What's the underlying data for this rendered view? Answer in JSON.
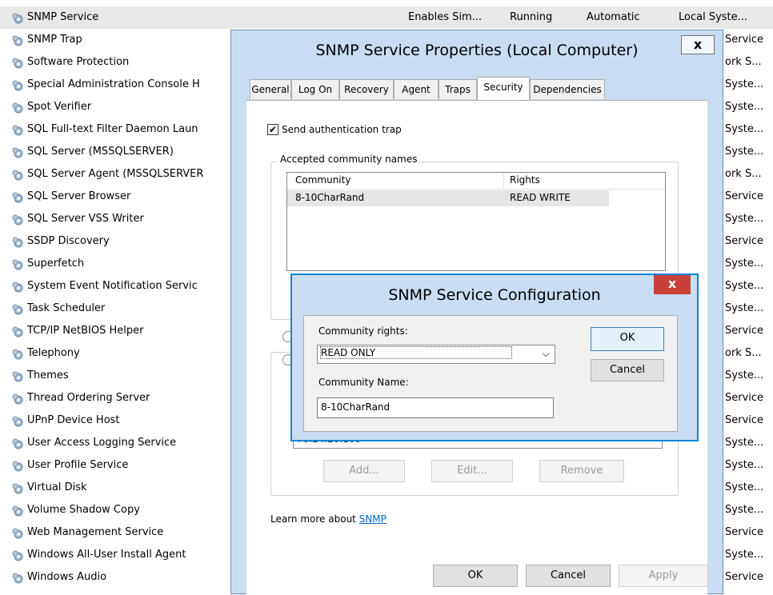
{
  "services": [
    {
      "name": "SNMP Service",
      "description": "Enables Sim...",
      "status": "Running",
      "startup": "Automatic",
      "logon": "Local Syste..."
    },
    {
      "name": "SNMP Trap",
      "logon": "Service"
    },
    {
      "name": "Software Protection",
      "logon": "ork S..."
    },
    {
      "name": "Special Administration Console H",
      "logon": "Syste..."
    },
    {
      "name": "Spot Verifier",
      "logon": "Syste..."
    },
    {
      "name": "SQL Full-text Filter Daemon Laun",
      "logon": "Syste..."
    },
    {
      "name": "SQL Server (MSSQLSERVER)",
      "logon": "Syste..."
    },
    {
      "name": "SQL Server Agent (MSSQLSERVER",
      "logon": "ork S..."
    },
    {
      "name": "SQL Server Browser",
      "logon": "Service"
    },
    {
      "name": "SQL Server VSS Writer",
      "logon": "Syste..."
    },
    {
      "name": "SSDP Discovery",
      "logon": "Service"
    },
    {
      "name": "Superfetch",
      "logon": "Syste..."
    },
    {
      "name": "System Event Notification Servic",
      "logon": "Syste..."
    },
    {
      "name": "Task Scheduler",
      "logon": "Syste..."
    },
    {
      "name": "TCP/IP NetBIOS Helper",
      "logon": "Service"
    },
    {
      "name": "Telephony",
      "logon": "ork S..."
    },
    {
      "name": "Themes",
      "logon": "Syste..."
    },
    {
      "name": "Thread Ordering Server",
      "logon": "Service"
    },
    {
      "name": "UPnP Device Host",
      "logon": "Service"
    },
    {
      "name": "User Access Logging Service",
      "logon": "Syste..."
    },
    {
      "name": "User Profile Service",
      "logon": "Syste..."
    },
    {
      "name": "Virtual Disk",
      "logon": "Syste..."
    },
    {
      "name": "Volume Shadow Copy",
      "logon": "Syste..."
    },
    {
      "name": "Web Management Service",
      "logon": "Service"
    },
    {
      "name": "Windows All-User Install Agent",
      "logon": "Syste..."
    },
    {
      "name": "Windows Audio",
      "logon": "Service"
    }
  ],
  "properties": {
    "title": "SNMP Service Properties (Local Computer)",
    "close": "x",
    "tabs": [
      "General",
      "Log On",
      "Recovery",
      "Agent",
      "Traps",
      "Security",
      "Dependencies"
    ],
    "active_tab": "Security",
    "auth_trap_label": "Send authentication trap",
    "auth_trap_checked": true,
    "community_group_title": "Accepted community names",
    "columns": [
      "Community",
      "Rights"
    ],
    "communities": [
      {
        "community": "8-10CharRand",
        "rights": "READ WRITE"
      }
    ],
    "host_partial": "70.24.26.100",
    "add": "Add...",
    "edit": "Edit...",
    "remove": "Remove",
    "learn_prefix": "Learn more about ",
    "learn_link": "SNMP",
    "ok": "OK",
    "cancel": "Cancel",
    "apply": "Apply"
  },
  "config_dialog": {
    "title": "SNMP Service Configuration",
    "close": "x",
    "rights_label": "Community rights:",
    "rights_value": "READ ONLY",
    "name_label": "Community Name:",
    "name_value": "8-10CharRand",
    "ok": "OK",
    "cancel": "Cancel"
  },
  "colors": {
    "accent": "#0a84d8",
    "title_bg": "#c9dcf1",
    "close_red": "#c7413a",
    "link": "#0066cc"
  },
  "icons": {
    "service": "gear-icon",
    "close": "close-icon",
    "dropdown": "chevron-down-icon",
    "check": "checkmark-icon"
  }
}
